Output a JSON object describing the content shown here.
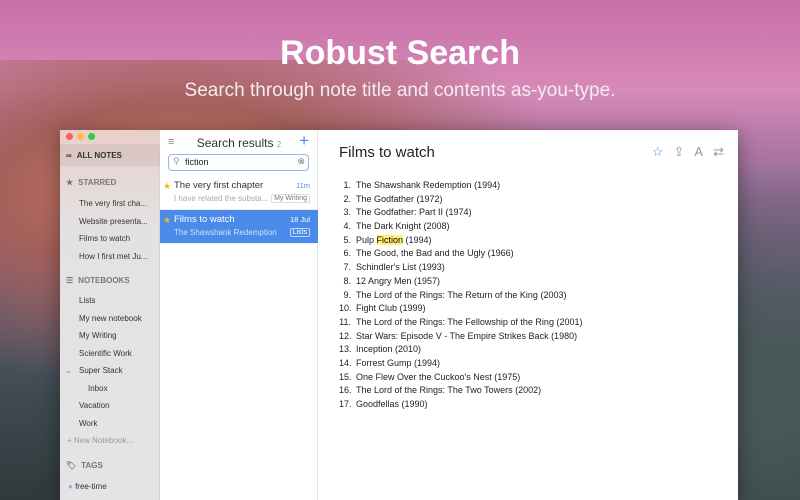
{
  "hero": {
    "title": "Robust Search",
    "subtitle": "Search through note title and contents as-you-type."
  },
  "sidebar": {
    "all_notes": "ALL NOTES",
    "starred_header": "STARRED",
    "starred": [
      "The very first cha...",
      "Website presenta...",
      "Films to watch",
      "How I first met Ju..."
    ],
    "notebooks_header": "NOTEBOOKS",
    "notebooks": [
      "Lists",
      "My new notebook",
      "My Writing",
      "Scientific Work",
      "Super Stack",
      "Inbox",
      "Vacation",
      "Work"
    ],
    "new_notebook": "New Notebook...",
    "tags_header": "TAGS",
    "tags": [
      "free-time"
    ]
  },
  "list": {
    "title": "Search results",
    "count": "2",
    "search_value": "fiction",
    "notes": [
      {
        "title": "The very first chapter",
        "preview": "I have related the substa...",
        "time": "11m",
        "notebook": "My Writing",
        "starred": true
      },
      {
        "title": "Films to watch",
        "preview": "The Shawshank Redemption (...",
        "time": "18 Jul",
        "notebook": "Lists",
        "starred": true
      }
    ]
  },
  "editor": {
    "title": "Films to watch",
    "highlight": "Fiction",
    "items": [
      "The Shawshank Redemption (1994)",
      "The Godfather (1972)",
      "The Godfather: Part II (1974)",
      "The Dark Knight (2008)",
      "Pulp |Fiction| (1994)",
      "The Good, the Bad and the Ugly (1966)",
      "Schindler's List (1993)",
      "12 Angry Men (1957)",
      "The Lord of the Rings: The Return of the King (2003)",
      "Fight Club (1999)",
      "The Lord of the Rings: The Fellowship of the Ring (2001)",
      "Star Wars: Episode V - The Empire Strikes Back (1980)",
      "Inception (2010)",
      "Forrest Gump (1994)",
      "One Flew Over the Cuckoo's Nest (1975)",
      "The Lord of the Rings: The Two Towers (2002)",
      "Goodfellas (1990)"
    ]
  },
  "colors": {
    "accent": "#4a8ae8",
    "highlight": "#fff27a",
    "star": "#f2b824"
  }
}
